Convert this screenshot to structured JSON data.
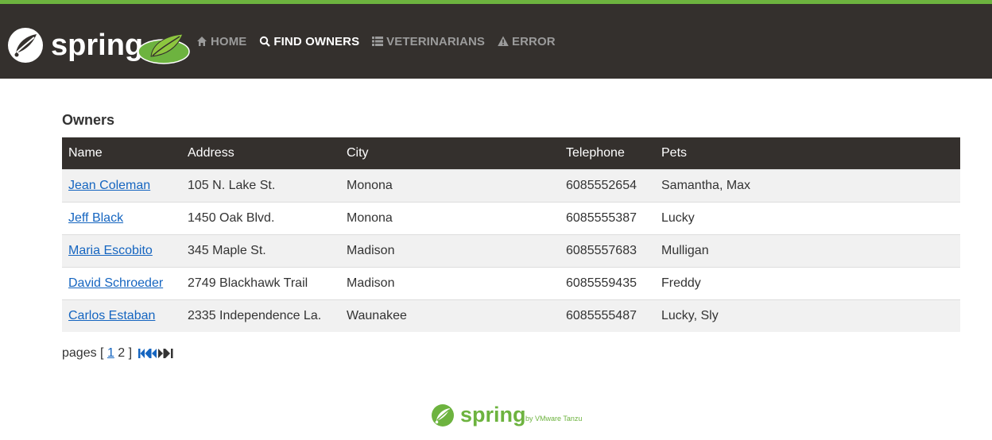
{
  "header": {
    "logo_text": "spring",
    "nav": [
      {
        "label": "HOME",
        "icon": "home-icon",
        "active": false
      },
      {
        "label": "FIND OWNERS",
        "icon": "search-icon",
        "active": true
      },
      {
        "label": "VETERINARIANS",
        "icon": "list-icon",
        "active": false
      },
      {
        "label": "ERROR",
        "icon": "warning-icon",
        "active": false
      }
    ]
  },
  "main": {
    "title": "Owners",
    "table": {
      "columns": [
        "Name",
        "Address",
        "City",
        "Telephone",
        "Pets"
      ],
      "rows": [
        {
          "name": "Jean Coleman",
          "address": "105 N. Lake St.",
          "city": "Monona",
          "telephone": "6085552654",
          "pets": "Samantha, Max"
        },
        {
          "name": "Jeff Black",
          "address": "1450 Oak Blvd.",
          "city": "Monona",
          "telephone": "6085555387",
          "pets": "Lucky"
        },
        {
          "name": "Maria Escobito",
          "address": "345 Maple St.",
          "city": "Madison",
          "telephone": "6085557683",
          "pets": "Mulligan"
        },
        {
          "name": "David Schroeder",
          "address": "2749 Blackhawk Trail",
          "city": "Madison",
          "telephone": "6085559435",
          "pets": "Freddy"
        },
        {
          "name": "Carlos Estaban",
          "address": "2335 Independence La.",
          "city": "Waunakee",
          "telephone": "6085555487",
          "pets": "Lucky, Sly"
        }
      ]
    },
    "pagination": {
      "prefix": "pages [ ",
      "link_page": "1",
      "current_page": "2",
      "suffix": " ]",
      "controls": [
        "first-page-icon",
        "previous-page-icon",
        "next-page-icon",
        "last-page-icon"
      ]
    }
  },
  "footer": {
    "logo_text": "spring",
    "tagline": "by VMware Tanzu"
  },
  "colors": {
    "brand_green": "#6db33f",
    "header_bg": "#34302d",
    "link_blue": "#1565c0"
  }
}
